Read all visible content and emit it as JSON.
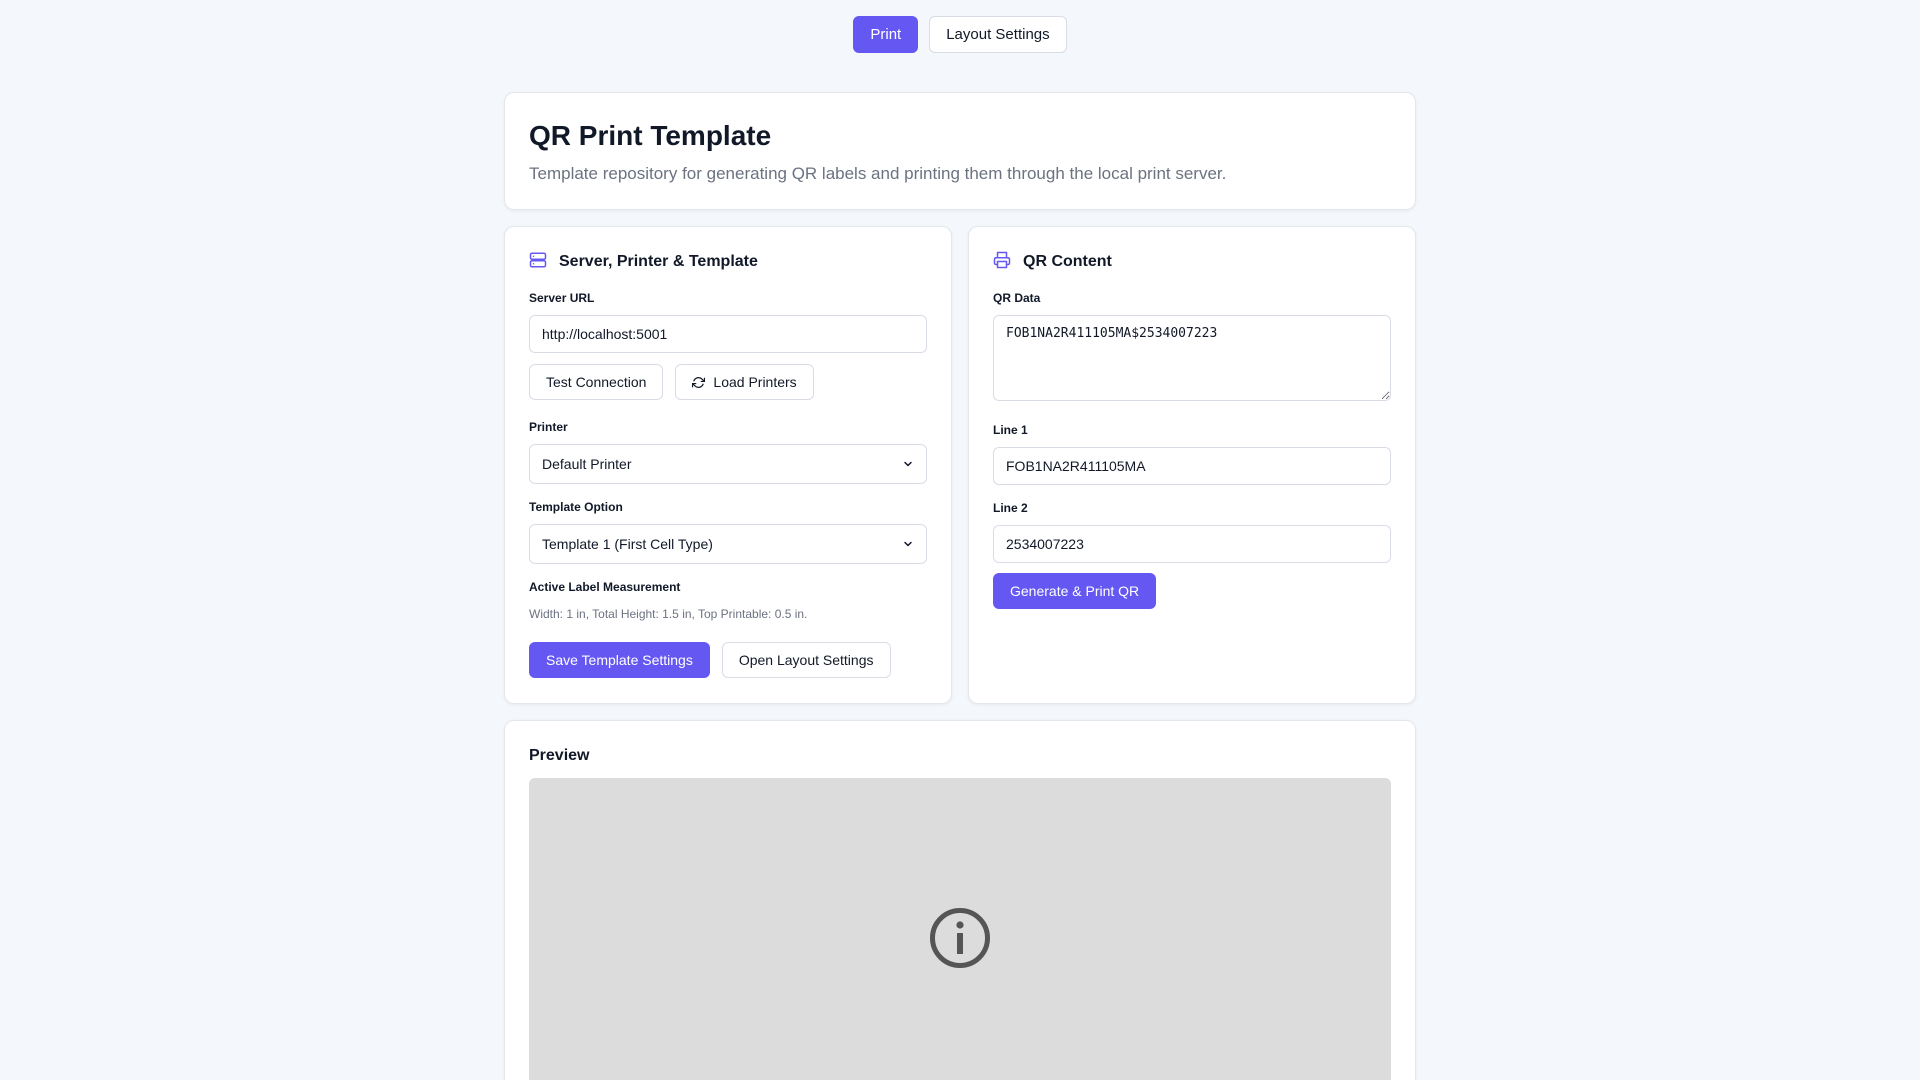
{
  "nav": {
    "print_label": "Print",
    "layout_label": "Layout Settings"
  },
  "hero": {
    "title": "QR Print Template",
    "subtitle": "Template repository for generating QR labels and printing them through the local print server."
  },
  "left_panel": {
    "title": "Server, Printer & Template",
    "icon": "server-icon",
    "server_url_label": "Server URL",
    "server_url_value": "http://localhost:5001",
    "test_connection_label": "Test Connection",
    "load_printers_label": "Load Printers",
    "printer_label": "Printer",
    "printer_value": "Default Printer",
    "template_label": "Template Option",
    "template_value": "Template 1 (First Cell Type)",
    "measurement_label": "Active Label Measurement",
    "measurement_value": "Width: 1 in, Total Height: 1.5 in, Top Printable: 0.5 in.",
    "save_label": "Save Template Settings",
    "open_layout_label": "Open Layout Settings"
  },
  "right_panel": {
    "title": "QR Content",
    "icon": "printer-icon",
    "qr_data_label": "QR Data",
    "qr_data_value": "FOB1NA2R411105MA$2534007223",
    "line1_label": "Line 1",
    "line1_value": "FOB1NA2R411105MA",
    "line2_label": "Line 2",
    "line2_value": "2534007223",
    "generate_label": "Generate & Print QR"
  },
  "preview": {
    "title": "Preview",
    "icon": "info-icon"
  },
  "colors": {
    "accent": "#6457f2",
    "background": "#f4f7fb",
    "preview_bg": "#dcdcdc"
  }
}
